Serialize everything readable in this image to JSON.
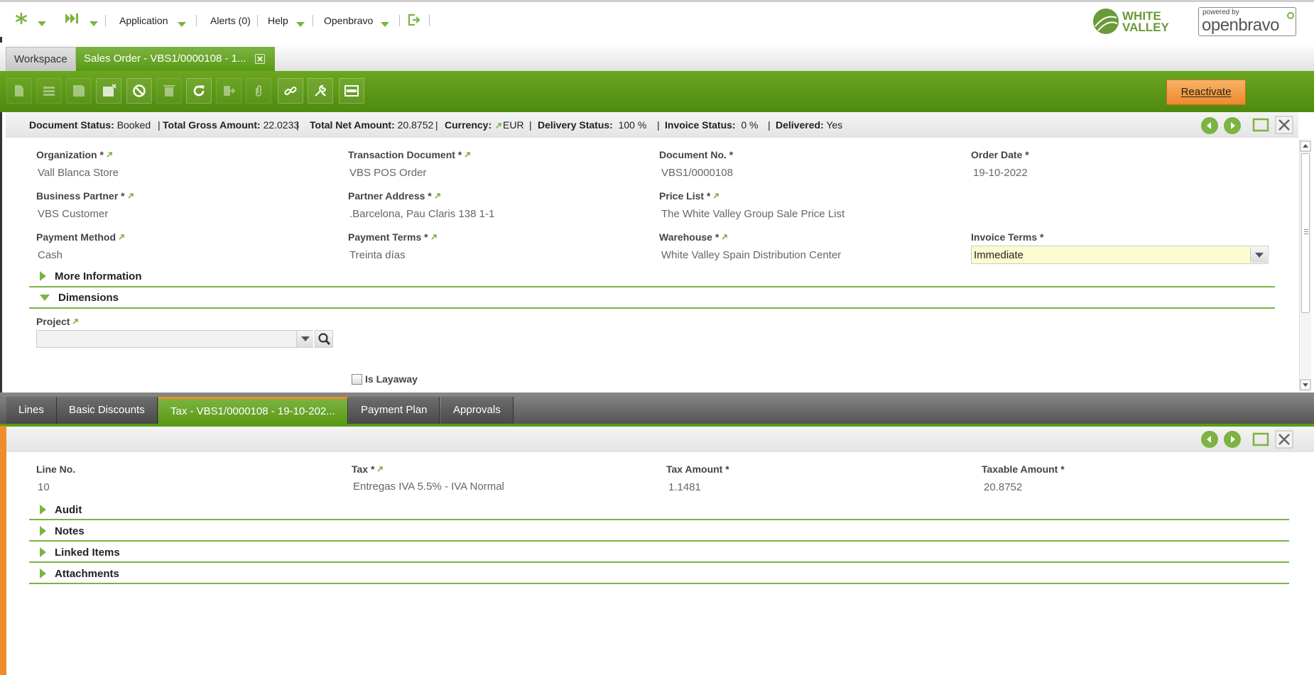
{
  "topbar": {
    "menus": [
      "Application",
      "Alerts (0)",
      "Help",
      "Openbravo"
    ],
    "brand": {
      "line1": "WHITE",
      "line2": "VALLEY"
    },
    "powered_by": "powered by",
    "openbravo_logo": "openbravo"
  },
  "window_tabs": [
    {
      "label": "Workspace",
      "active": false
    },
    {
      "label": "Sales Order - VBS1/0000108 - 1...",
      "active": true
    }
  ],
  "toolbar": {
    "icons": [
      "new-document-icon",
      "new-row-icon",
      "save-icon",
      "save-close-icon",
      "cancel-icon",
      "delete-icon",
      "refresh-icon",
      "export-icon",
      "attachment-icon",
      "link-icon",
      "tools-icon",
      "form-grid-toggle-icon"
    ],
    "reactivate_label": "Reactivate"
  },
  "status": {
    "doc_status_label": "Document Status:",
    "doc_status": "Booked",
    "gross_label": "Total Gross Amount:",
    "gross": "22.0233",
    "net_label": "Total Net Amount:",
    "net": "20.8752",
    "currency_label": "Currency:",
    "currency": "EUR",
    "delivery_label": "Delivery Status:",
    "delivery": "100 %",
    "invoice_label": "Invoice Status:",
    "invoice": "0 %",
    "delivered_label": "Delivered:",
    "delivered": "Yes",
    "sep": "|"
  },
  "header_form": {
    "fields": [
      {
        "label": "Organization *",
        "value": "Vall Blanca Store"
      },
      {
        "label": "Transaction Document *",
        "value": "VBS POS Order"
      },
      {
        "label": "Document No. *",
        "value": "VBS1/0000108"
      },
      {
        "label": "Order Date *",
        "value": "19-10-2022"
      },
      {
        "label": "Business Partner *",
        "value": "VBS Customer"
      },
      {
        "label": "Partner Address *",
        "value": ".Barcelona, Pau Claris 138 1-1"
      },
      {
        "label": "Price List *",
        "value": "The White Valley Group Sale Price List"
      },
      {
        "label": "Payment Method",
        "value": "Cash"
      },
      {
        "label": "Payment Terms *",
        "value": "Treinta días"
      },
      {
        "label": "Warehouse *",
        "value": "White Valley Spain Distribution Center"
      },
      {
        "label": "Invoice Terms *",
        "value": "Immediate"
      }
    ],
    "more_info": "More Information",
    "dimensions": "Dimensions",
    "project_label": "Project",
    "project_value": "",
    "layaway_label": "Is Layaway",
    "layaway_checked": false
  },
  "subtabs": [
    {
      "label": "Lines",
      "active": false
    },
    {
      "label": "Basic Discounts",
      "active": false
    },
    {
      "label": "Tax - VBS1/0000108 - 19-10-202...",
      "active": true
    },
    {
      "label": "Payment Plan",
      "active": false
    },
    {
      "label": "Approvals",
      "active": false
    }
  ],
  "tax_form": {
    "fields": [
      {
        "label": "Line No.",
        "value": "10"
      },
      {
        "label": "Tax *",
        "value": "Entregas IVA 5.5% - IVA Normal"
      },
      {
        "label": "Tax Amount *",
        "value": "1.1481"
      },
      {
        "label": "Taxable Amount *",
        "value": "20.8752"
      }
    ],
    "sections": [
      "Audit",
      "Notes",
      "Linked Items",
      "Attachments"
    ]
  },
  "colors": {
    "accent": "#7cb342",
    "toolbar": "#5a9a15",
    "orange": "#f08c2d",
    "highlight_field": "#fdfbd0"
  }
}
